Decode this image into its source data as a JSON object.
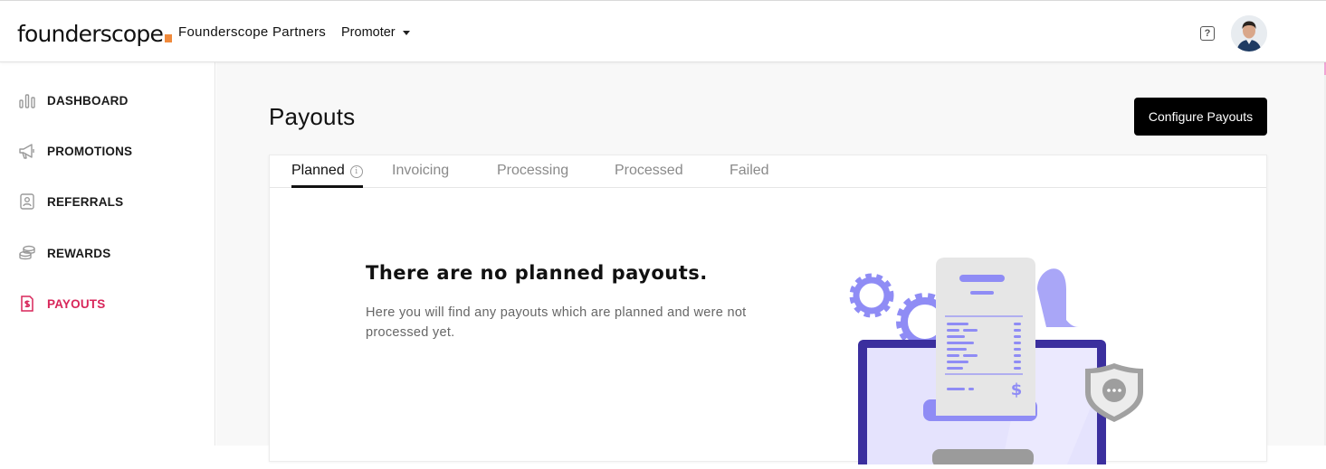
{
  "header": {
    "logo_text": "founderscope",
    "org_name": "Founderscope Partners",
    "role": "Promoter",
    "help_glyph": "?"
  },
  "sidebar": {
    "items": [
      {
        "label": "DASHBOARD",
        "icon": "bar-chart-icon",
        "active": false
      },
      {
        "label": "PROMOTIONS",
        "icon": "megaphone-icon",
        "active": false
      },
      {
        "label": "REFERRALS",
        "icon": "contact-card-icon",
        "active": false
      },
      {
        "label": "REWARDS",
        "icon": "coins-icon",
        "active": false
      },
      {
        "label": "PAYOUTS",
        "icon": "invoice-dollar-icon",
        "active": true
      }
    ]
  },
  "main": {
    "title": "Payouts",
    "configure_button": "Configure Payouts",
    "tabs": [
      {
        "label": "Planned",
        "active": true
      },
      {
        "label": "Invoicing",
        "active": false
      },
      {
        "label": "Processing",
        "active": false
      },
      {
        "label": "Processed",
        "active": false
      },
      {
        "label": "Failed",
        "active": false
      }
    ],
    "info_glyph": "i",
    "empty_state": {
      "title": "There are no planned payouts.",
      "description": "Here you will find any payouts which are planned and were not processed yet."
    }
  },
  "colors": {
    "accent": "#d8265a",
    "primary_button": "#000000",
    "illustration_purple": "#8f8cf5",
    "illustration_dark": "#3b2f9e",
    "logo_orange": "#f08a3c"
  }
}
